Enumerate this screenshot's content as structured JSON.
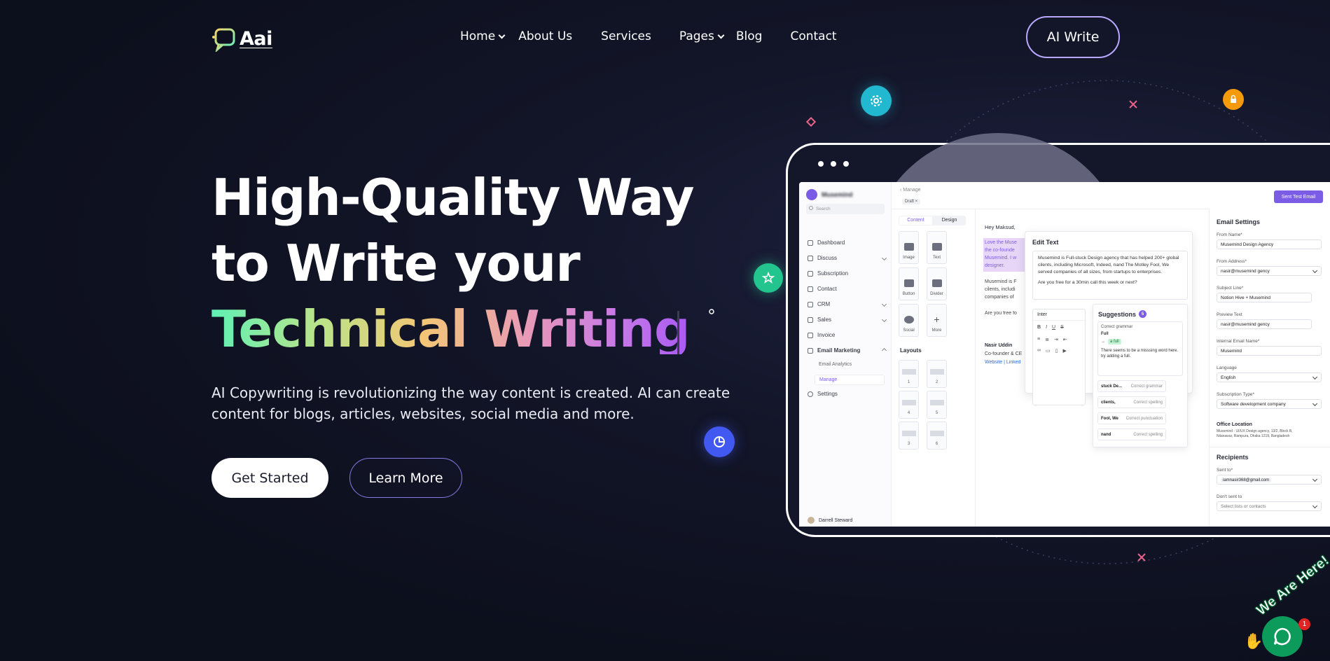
{
  "header": {
    "logo_text": "Aai",
    "nav": [
      {
        "label": "Home",
        "has_dropdown": true
      },
      {
        "label": "About Us",
        "has_dropdown": false
      },
      {
        "label": "Services",
        "has_dropdown": false
      },
      {
        "label": "Pages",
        "has_dropdown": true
      },
      {
        "label": "Blog",
        "has_dropdown": false
      },
      {
        "label": "Contact",
        "has_dropdown": false
      }
    ],
    "cta": "AI Write"
  },
  "hero": {
    "line1": "High-Quality Way",
    "line2": "to Write your",
    "line3": "Technical Writing",
    "subtitle": "AI Copywriting is revolutionizing the way content is created. AI can create content for blogs, articles, websites, social media and more.",
    "primary_button": "Get Started",
    "secondary_button": "Learn More"
  },
  "mockup": {
    "brand": "Musemind",
    "search_placeholder": "Search",
    "sidebar": [
      {
        "label": "Dashboard",
        "chevron": false
      },
      {
        "label": "Discuss",
        "chevron": true
      },
      {
        "label": "Subscription",
        "chevron": false
      },
      {
        "label": "Contact",
        "chevron": false
      },
      {
        "label": "CRM",
        "chevron": true
      },
      {
        "label": "Sales",
        "chevron": true
      },
      {
        "label": "Invoice",
        "chevron": false
      },
      {
        "label": "Email Marketing",
        "chevron": true
      }
    ],
    "sub_items": [
      "Email Analytics",
      "Manage"
    ],
    "settings": "Settings",
    "user_name": "Darrell Steward",
    "back_label": "Manage",
    "draft_chip": "Draft",
    "send_test": "Sent Test Email",
    "tabs": [
      "Content",
      "Design"
    ],
    "tiles": [
      "Image",
      "Text",
      "Button",
      "Divider",
      "Social",
      "More"
    ],
    "layouts_title": "Layouts",
    "layouts": [
      "1",
      "2",
      "4",
      "5",
      "3",
      "6"
    ],
    "email": {
      "greeting": "Hey Maksud,",
      "highlight": "Love the Muse the co-founde Musemind. I w designer.",
      "p2": "Musemind is F cilents, includi companies of",
      "p3": "Are you free fo",
      "sig_name": "Nasir Uddin",
      "sig_title": "Co-founder & CE",
      "sig_links": "Website | Linked"
    },
    "edit_text": {
      "title": "Edit Text",
      "body": "Musemind is Full-stuck Design agency that has helped 200+ global cilents, including Microsoft, Indeed, nand The Motley Fool, We served companies of all sizes, from startups to enterprises.",
      "question": "Are you free for a 30min call this week or next?",
      "font": "Inter"
    },
    "suggestions": {
      "title": "Suggestions",
      "count": "5",
      "main_label": "Correct grammar",
      "main_word": "Full",
      "main_fix": "a full",
      "main_note": "There seems to be a misssing word here. try adding a full.",
      "items": [
        {
          "word": "stuck De...",
          "fix": "Correct grammar"
        },
        {
          "word": "clients,",
          "fix": "Correct spelling"
        },
        {
          "word": "Fool, We",
          "fix": "Correct punctuation"
        },
        {
          "word": "nand",
          "fix": "Correct spelling"
        }
      ]
    },
    "email_settings": {
      "title": "Email Settings",
      "fields": [
        {
          "label": "From Name*",
          "value": "Musemind Design Agency",
          "select": false
        },
        {
          "label": "From Address*",
          "value": "nasir@musemind gency",
          "select": true
        },
        {
          "label": "Subject Line*",
          "value": "Notion Hive + Musemind",
          "select": false
        },
        {
          "label": "Preview Text",
          "value": "nasir@musemind gency",
          "select": false
        },
        {
          "label": "Internal Email Name*",
          "value": "Musemind",
          "select": false
        },
        {
          "label": "Language",
          "value": "English",
          "select": true
        },
        {
          "label": "Subscription Type*",
          "value": "Software development company",
          "select": true
        }
      ],
      "office_title": "Office Location",
      "office_text": "Musemind - UI/UX Design agency, 13/2, Block B, Nilanawar, Rampura, Dhaka 1219, Bangladesh",
      "recipients_title": "Recipients",
      "sent_to_label": "Sent to*",
      "sent_to_value": "iamnasir368@gmail.com",
      "dont_send_label": "Don't sent to",
      "dont_send_placeholder": "Select lists or contacts"
    }
  },
  "chat": {
    "banner": "We Are Here!",
    "badge": "1"
  },
  "colors": {
    "background": "#0f1221",
    "accent_purple": "#7b5ce5",
    "teal_icon": "#22b9d0",
    "orange_icon": "#f59a0b",
    "green_icon": "#23c48e",
    "blue_icon": "#4159f0",
    "chat_green": "#0d9b5c"
  }
}
